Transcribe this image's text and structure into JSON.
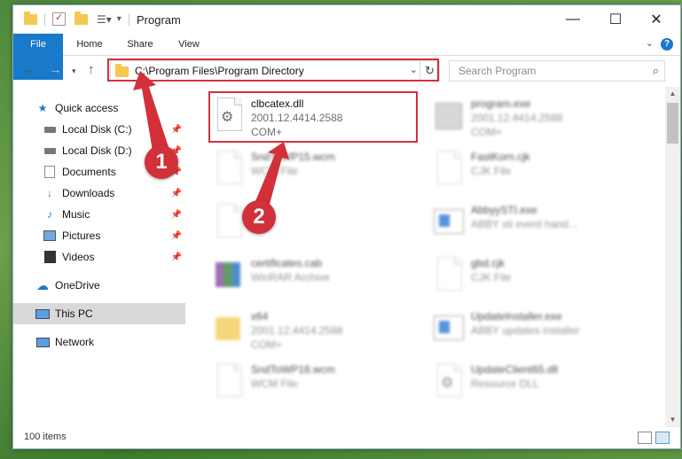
{
  "window": {
    "title": "Program"
  },
  "ribbon": {
    "tabs": [
      "File",
      "Home",
      "Share",
      "View"
    ],
    "help": "?"
  },
  "address": {
    "path": "C:\\Program Files\\Program Directory"
  },
  "search": {
    "placeholder": "Search Program"
  },
  "nav": {
    "items": [
      {
        "label": "Quick access",
        "icon": "star-icon"
      },
      {
        "label": "Local Disk (C:)",
        "icon": "drive-icon",
        "pinned": true
      },
      {
        "label": "Local Disk (D:)",
        "icon": "drive-icon",
        "pinned": true
      },
      {
        "label": "Documents",
        "icon": "documents-icon",
        "pinned": true
      },
      {
        "label": "Downloads",
        "icon": "download-icon",
        "pinned": true
      },
      {
        "label": "Music",
        "icon": "music-icon",
        "pinned": true
      },
      {
        "label": "Pictures",
        "icon": "pictures-icon",
        "pinned": true
      },
      {
        "label": "Videos",
        "icon": "videos-icon",
        "pinned": true
      },
      {
        "label": "OneDrive",
        "icon": "cloud-icon"
      },
      {
        "label": "This PC",
        "icon": "computer-icon",
        "selected": true
      },
      {
        "label": "Network",
        "icon": "network-icon"
      }
    ]
  },
  "files": {
    "left": [
      {
        "name": "clbcatex.dll",
        "line1": "2001.12.4414.2588",
        "line2": "COM+",
        "highlighted": true
      },
      {
        "name": "SndToWP15.wcm",
        "line1": "WCM File",
        "line2": ""
      },
      {
        "name": "",
        "line1": "",
        "line2": ""
      },
      {
        "name": "certificates.cab",
        "line1": "WinRAR Archive",
        "line2": ""
      },
      {
        "name": "x64",
        "line1": "2001.12.4414.2588",
        "line2": "COM+"
      },
      {
        "name": "SndToWP16.wcm",
        "line1": "WCM File",
        "line2": ""
      }
    ],
    "right": [
      {
        "name": "program.exe",
        "line1": "2001.12.4414.2588",
        "line2": "COM+"
      },
      {
        "name": "FastKorn.cjk",
        "line1": "CJK File",
        "line2": ""
      },
      {
        "name": "AbbyySTI.exe",
        "line1": "ABBY sti event hand...",
        "line2": ""
      },
      {
        "name": "gbd.cjk",
        "line1": "CJK File",
        "line2": ""
      },
      {
        "name": "UpdateInstaller.exe",
        "line1": "ABBY updates installer",
        "line2": ""
      },
      {
        "name": "UpdateClient65.dll",
        "line1": "Resource DLL",
        "line2": ""
      }
    ]
  },
  "status": {
    "item_count": "100 items"
  },
  "annotations": {
    "step1": "1",
    "step2": "2",
    "color": "#d2313a"
  },
  "colors": {
    "accent": "#1979ca",
    "highlight": "#d2313a"
  }
}
